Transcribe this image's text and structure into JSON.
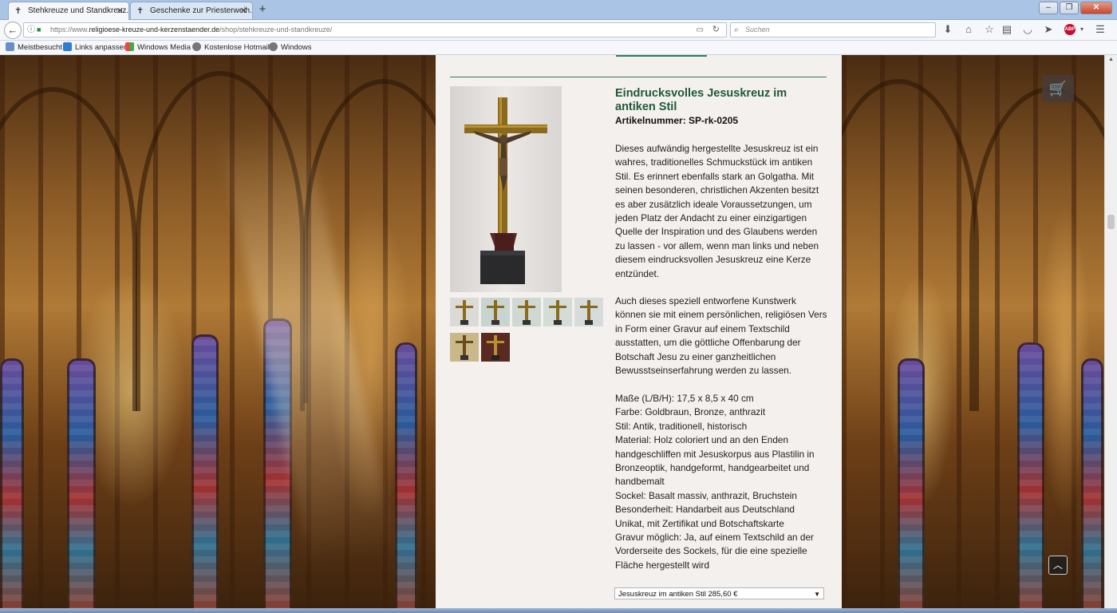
{
  "browser": {
    "tabs": [
      {
        "label": "Stehkreuze und Standkreuz...",
        "active": true
      },
      {
        "label": "Geschenke zur Priesterweih...",
        "active": false
      }
    ],
    "new_tab": "+",
    "url": {
      "prefix": "https://www.",
      "domain": "religioese-kreuze-und-kerzenstaender.de",
      "path": "/shop/stehkreuze-und-standkreuze/"
    },
    "search_placeholder": "Suchen",
    "bookmarks": [
      "Meistbesucht",
      "Links anpassen",
      "Windows Media",
      "Kostenlose Hotmail",
      "Windows"
    ]
  },
  "product": {
    "title": "Eindrucksvolles Jesuskreuz im antiken Stil",
    "sku": "Artikelnummer: SP-rk-0205",
    "description_lines_1": [
      "Dieses aufwändig hergestellte Jesuskreuz ist ein",
      "wahres, traditionelles Schmuckstück im antiken",
      "Stil. Es erinnert ebenfalls stark an Golgatha. Mit",
      "seinen besonderen, christlichen Akzenten besitzt",
      "es aber zusätzlich ideale Voraussetzungen, um",
      "jeden Platz der Andacht zu einer einzigartigen",
      "Quelle der Inspiration und des Glaubens werden",
      "zu lassen - vor allem, wenn man links und neben",
      "diesem eindrucksvollen Jesuskreuz eine Kerze",
      "entzündet."
    ],
    "description_lines_2": [
      "Auch dieses speziell entworfene Kunstwerk",
      "können sie mit einem persönlichen, religiösen Vers",
      "in Form einer Gravur auf einem Textschild",
      "ausstatten, um die göttliche Offenbarung der",
      "Botschaft Jesu zu einer ganzheitlichen",
      "Bewusstseinserfahrung werden zu lassen."
    ],
    "spec_lines": [
      "Maße (L/B/H): 17,5 x 8,5 x 40 cm",
      "Farbe: Goldbraun, Bronze, anthrazit",
      "Stil: Antik, traditionell, historisch",
      "Material: Holz coloriert und an den Enden",
      "handgeschliffen mit Jesuskorpus aus Plastilin in",
      "Bronzeoptik, handgeformt, handgearbeitet und",
      "handbemalt",
      "Sockel: Basalt massiv, anthrazit, Bruchstein",
      "Besonderheit: Handarbeit aus Deutschland",
      "Unikat, mit Zertifikat und Botschaftskarte",
      "Gravur möglich: Ja, auf einem Textschild an der",
      "Vorderseite des Sockels, für die eine spezielle",
      "Fläche hergestellt wird"
    ],
    "variant_selected": "Jesuskreuz im antiken Stil 285,60 €"
  },
  "colors": {
    "title_green": "#1e5a36",
    "accent_line": "#2f7d67",
    "content_bg": "#f4f0ee"
  },
  "icons": [
    "cart-icon",
    "arrow-up-icon",
    "back-arrow-icon",
    "lock-icon",
    "reload-icon",
    "search-icon",
    "download-icon",
    "home-icon",
    "star-icon",
    "library-icon",
    "pocket-icon",
    "send-icon",
    "adblock-icon",
    "menu-icon"
  ]
}
